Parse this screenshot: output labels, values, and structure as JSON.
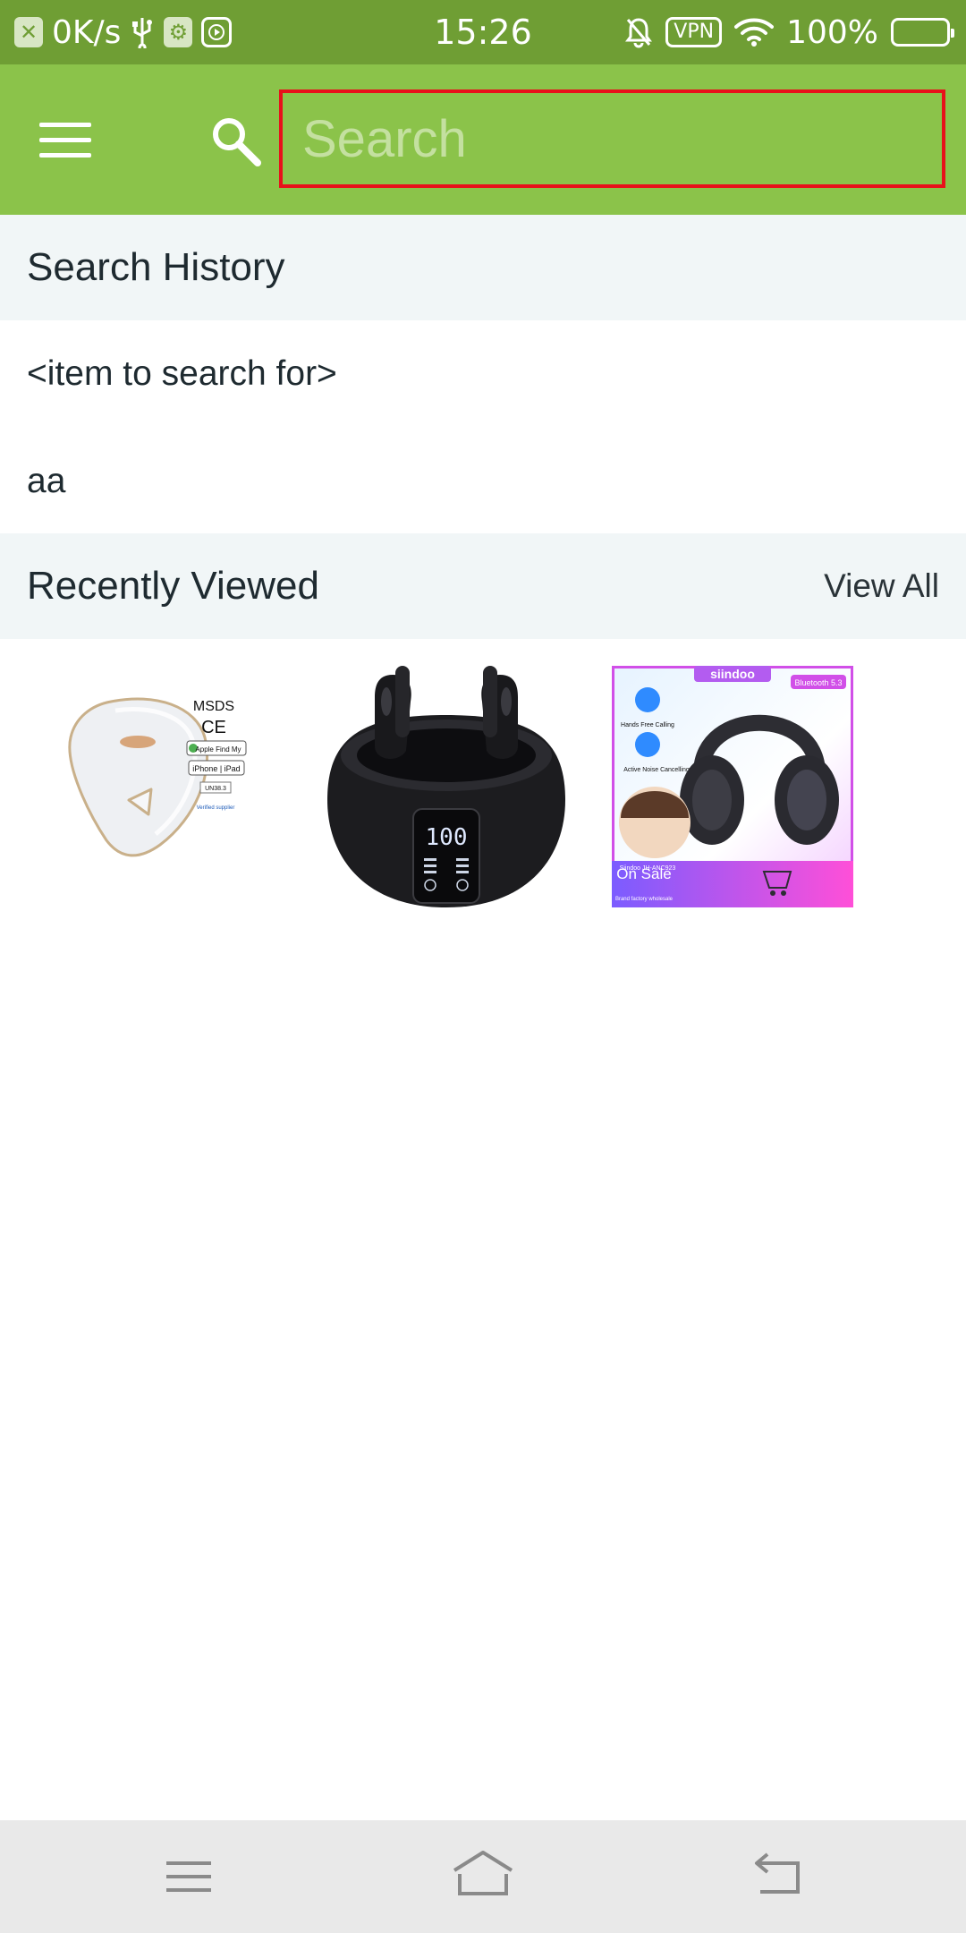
{
  "status_bar": {
    "net_speed": "0K/s",
    "time": "15:26",
    "vpn": "VPN",
    "battery": "100%"
  },
  "toolbar": {
    "menu_icon": "hamburger-menu-icon",
    "search_icon": "search-icon",
    "search_placeholder": "Search",
    "search_value": "",
    "colors": {
      "toolbar_bg": "#8bc34a",
      "status_bg": "#6f9e34",
      "focus_outline": "#e8111a"
    }
  },
  "search_history": {
    "title": "Search History",
    "items": [
      {
        "label": "<item to search for>"
      },
      {
        "label": "aa"
      }
    ]
  },
  "recently_viewed": {
    "title": "Recently Viewed",
    "view_all": "View All",
    "items": [
      {
        "name": "tracker-tag-product",
        "texts": [
          "MSDS",
          "CE",
          "Apple Find My",
          "iPhone | iPad",
          "UN38.3",
          "Verified supplier"
        ]
      },
      {
        "name": "wireless-earbuds-product",
        "texts": [
          "100"
        ]
      },
      {
        "name": "headphones-product",
        "texts": [
          "siindoo",
          "Bluetooth 5.3",
          "Hands Free Calling",
          "Active Noise Cancelling",
          "On Sale",
          "Brand factory wholesale",
          "Siindoo JH-ANC923"
        ]
      }
    ]
  },
  "nav_bar": {
    "menu_icon": "recent-apps-icon",
    "home_icon": "home-icon",
    "back_icon": "back-icon"
  }
}
